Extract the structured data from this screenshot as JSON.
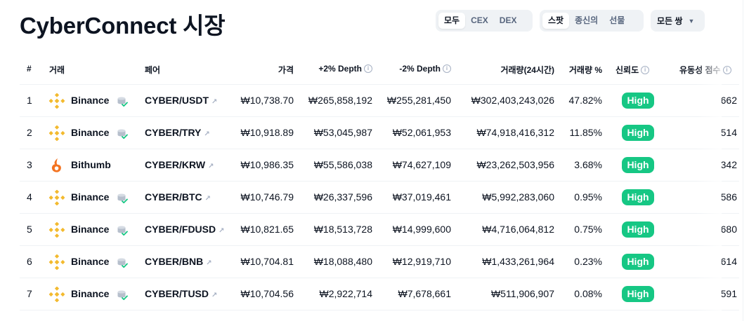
{
  "page_title": "CyberConnect 시장",
  "filters": {
    "exchange_type": [
      "모두",
      "CEX",
      "DEX"
    ],
    "market_type": [
      "스팟",
      "종신의",
      "선물"
    ],
    "pairs_select": "모든 쌍"
  },
  "colors": {
    "accent": "#3861fb",
    "trust_high": "#16c784",
    "binance": "#f3ba2f",
    "bithumb": "#f37321"
  },
  "table": {
    "headers": {
      "rank": "#",
      "exchange": "거래",
      "pair": "페어",
      "price": "가격",
      "depth_plus": "+2% Depth",
      "depth_minus": "-2% Depth",
      "volume": "거래량(24시간)",
      "volume_pct": "거래량 %",
      "trust": "신뢰도",
      "liquidity": "유동성 점수"
    },
    "rows": [
      {
        "rank": "1",
        "exchange": "Binance",
        "logo": "binance-logo",
        "pair": "CYBER/USDT",
        "price": "₩10,738.70",
        "depth_plus": "₩265,858,192",
        "depth_minus": "₩255,281,450",
        "volume": "₩302,403,243,026",
        "volume_pct": "47.82%",
        "trust": "High",
        "liquidity": "662"
      },
      {
        "rank": "2",
        "exchange": "Binance",
        "logo": "binance-logo",
        "pair": "CYBER/TRY",
        "price": "₩10,918.89",
        "depth_plus": "₩53,045,987",
        "depth_minus": "₩52,061,953",
        "volume": "₩74,918,416,312",
        "volume_pct": "11.85%",
        "trust": "High",
        "liquidity": "514"
      },
      {
        "rank": "3",
        "exchange": "Bithumb",
        "logo": "bithumb-logo",
        "pair": "CYBER/KRW",
        "price": "₩10,986.35",
        "depth_plus": "₩55,586,038",
        "depth_minus": "₩74,627,109",
        "volume": "₩23,262,503,956",
        "volume_pct": "3.68%",
        "trust": "High",
        "liquidity": "342"
      },
      {
        "rank": "4",
        "exchange": "Binance",
        "logo": "binance-logo",
        "pair": "CYBER/BTC",
        "price": "₩10,746.79",
        "depth_plus": "₩26,337,596",
        "depth_minus": "₩37,019,461",
        "volume": "₩5,992,283,060",
        "volume_pct": "0.95%",
        "trust": "High",
        "liquidity": "586"
      },
      {
        "rank": "5",
        "exchange": "Binance",
        "logo": "binance-logo",
        "pair": "CYBER/FDUSD",
        "price": "₩10,821.65",
        "depth_plus": "₩18,513,728",
        "depth_minus": "₩14,999,600",
        "volume": "₩4,716,064,812",
        "volume_pct": "0.75%",
        "trust": "High",
        "liquidity": "680"
      },
      {
        "rank": "6",
        "exchange": "Binance",
        "logo": "binance-logo",
        "pair": "CYBER/BNB",
        "price": "₩10,704.81",
        "depth_plus": "₩18,088,480",
        "depth_minus": "₩12,919,710",
        "volume": "₩1,433,261,964",
        "volume_pct": "0.23%",
        "trust": "High",
        "liquidity": "614"
      },
      {
        "rank": "7",
        "exchange": "Binance",
        "logo": "binance-logo",
        "pair": "CYBER/TUSD",
        "price": "₩10,704.56",
        "depth_plus": "₩2,922,714",
        "depth_minus": "₩7,678,661",
        "volume": "₩511,906,907",
        "volume_pct": "0.08%",
        "trust": "High",
        "liquidity": "591"
      }
    ]
  }
}
